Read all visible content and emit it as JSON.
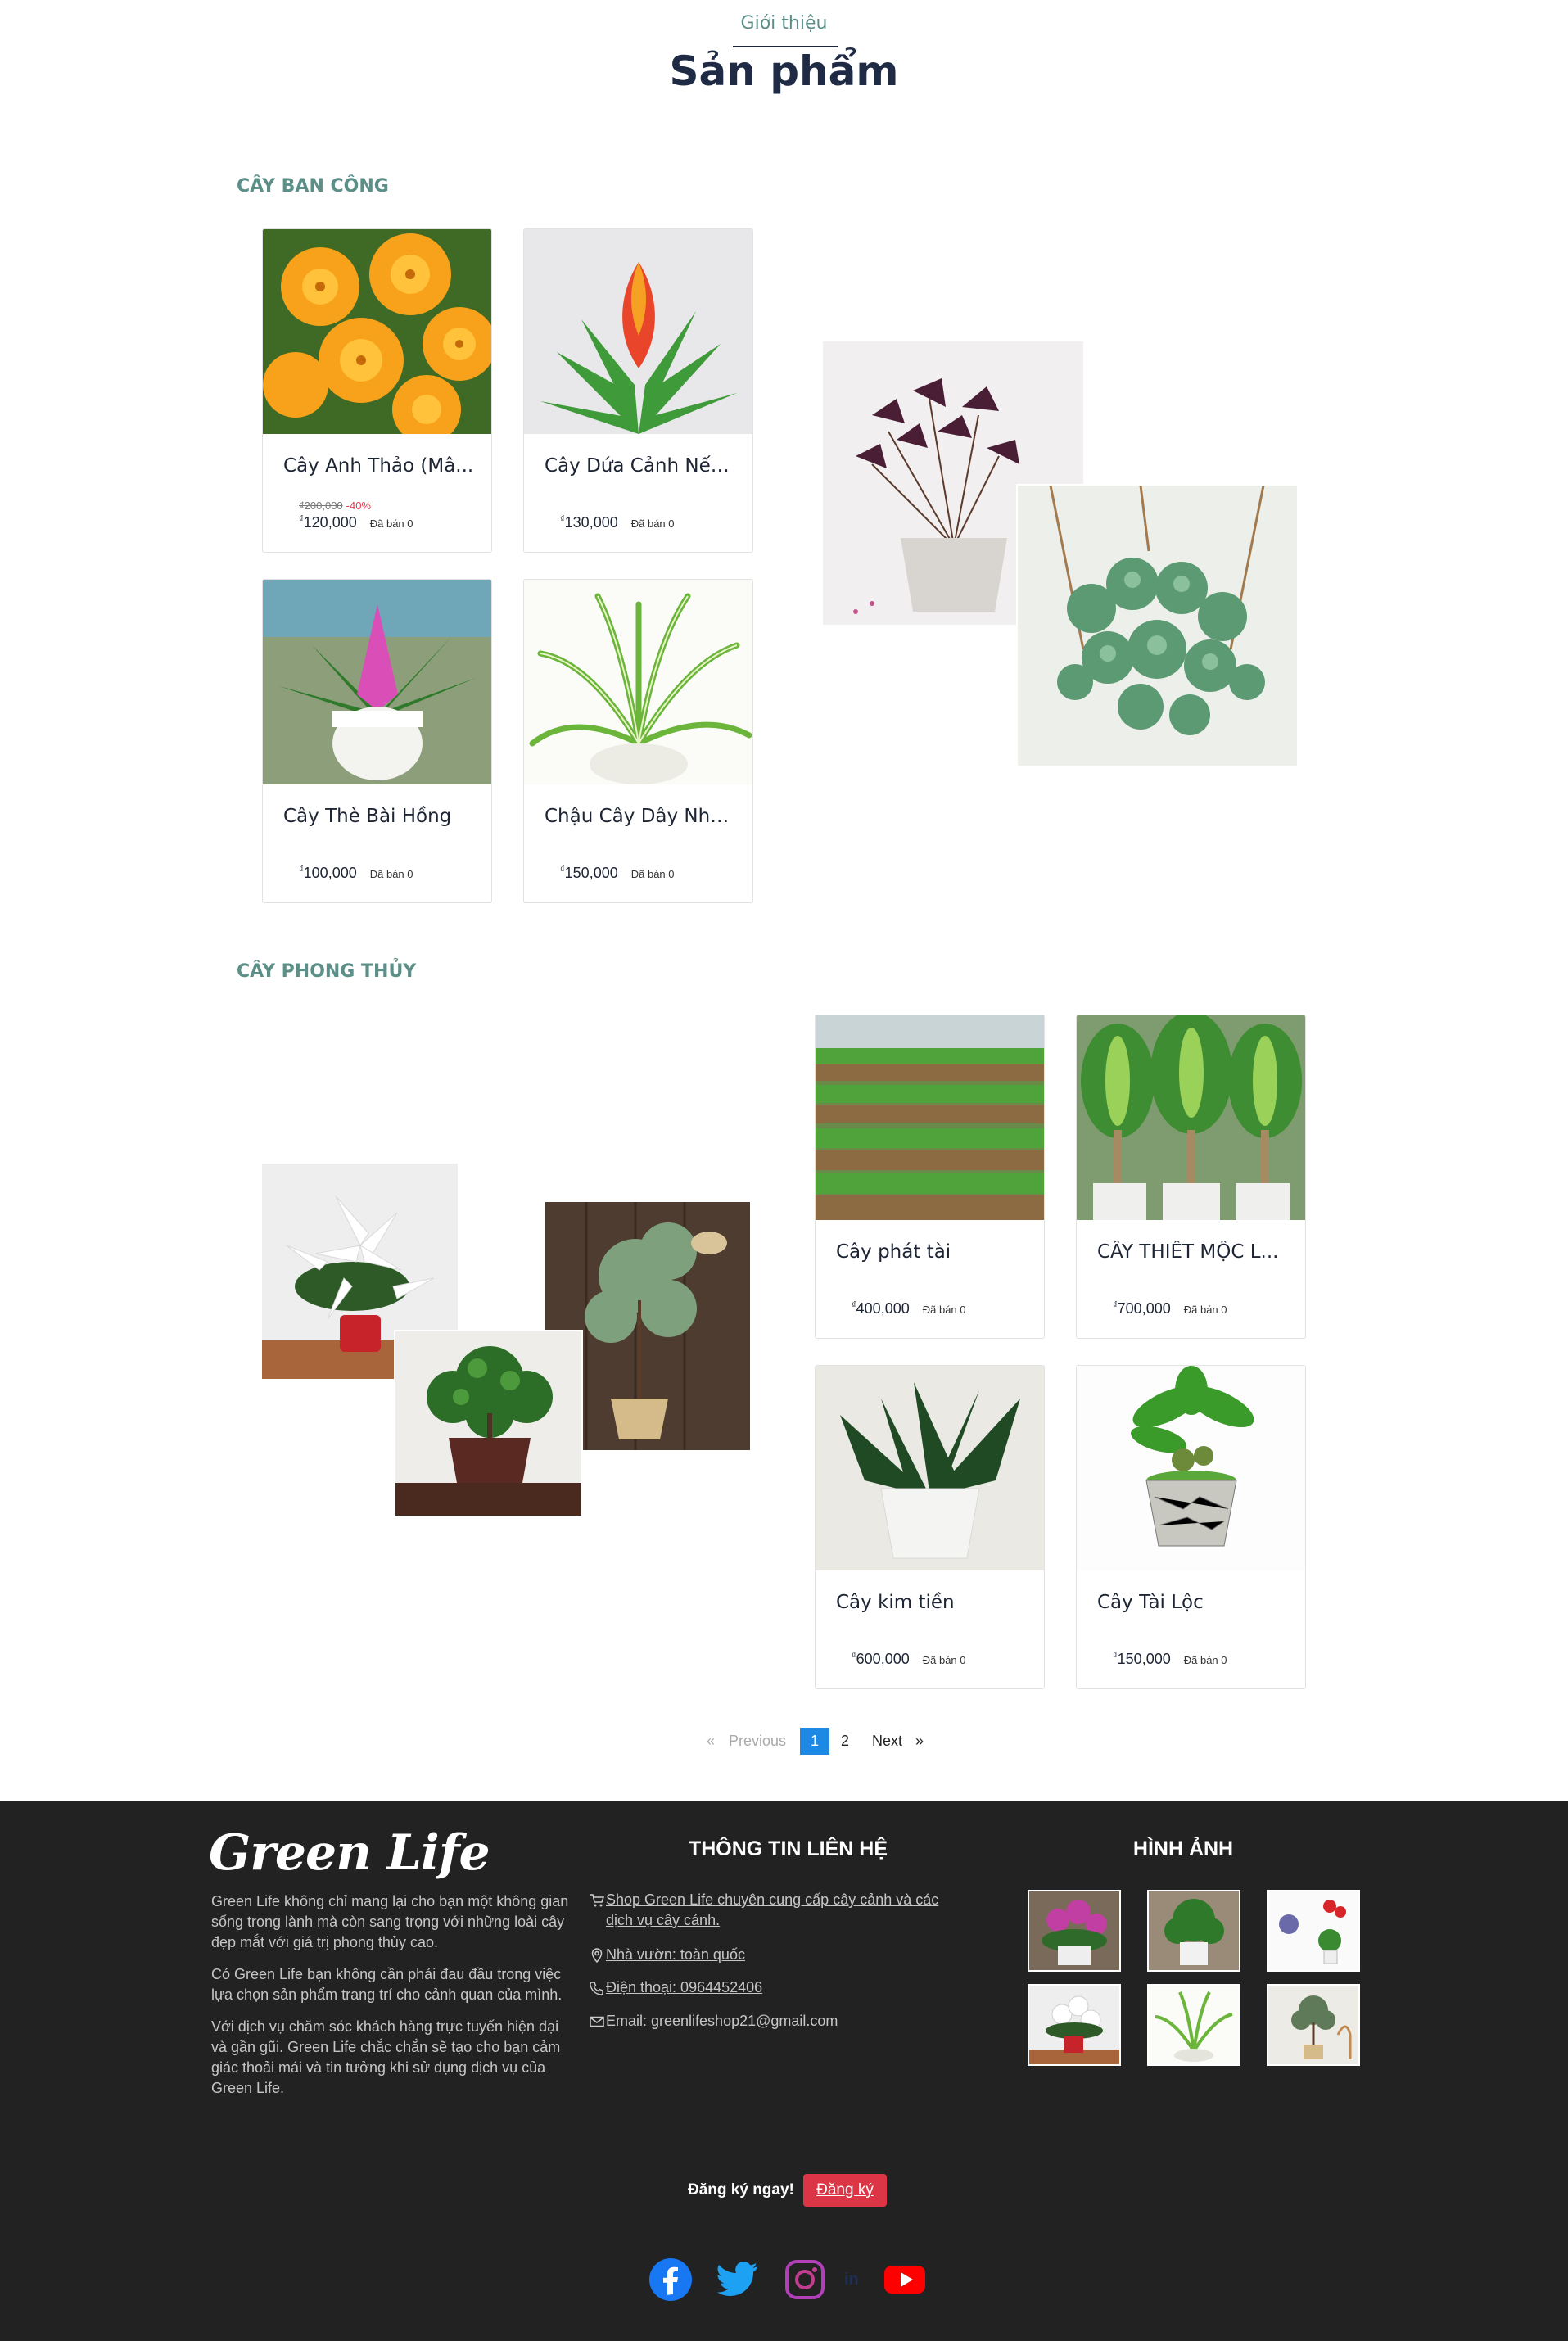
{
  "header": {
    "intro_link": "Giới thiệu",
    "title": "Sản phẩm"
  },
  "sections": [
    {
      "title": "CÂY BAN CÔNG",
      "products": [
        {
          "name": "Cây Anh Thảo (Mâ...",
          "old_price": "₫200,000",
          "discount": "-40%",
          "currency": "₫",
          "price": "120,000",
          "sold": "Đã bán 0"
        },
        {
          "name": "Cây Dứa Cảnh Nến...",
          "currency": "₫",
          "price": "130,000",
          "sold": "Đã bán 0"
        },
        {
          "name": "Cây Thè Bài Hồng",
          "currency": "₫",
          "price": "100,000",
          "sold": "Đã bán 0"
        },
        {
          "name": "Chậu Cây Dây Nhệ...",
          "currency": "₫",
          "price": "150,000",
          "sold": "Đã bán 0"
        }
      ]
    },
    {
      "title": "CÂY PHONG THỦY",
      "products": [
        {
          "name": "Cây phát tài",
          "currency": "₫",
          "price": "400,000",
          "sold": "Đã bán 0"
        },
        {
          "name": "CÂY THIẾT MỘC L...",
          "currency": "₫",
          "price": "700,000",
          "sold": "Đã bán 0"
        },
        {
          "name": "Cây kim tiền",
          "currency": "₫",
          "price": "600,000",
          "sold": "Đã bán 0"
        },
        {
          "name": "Cây Tài Lộc",
          "currency": "₫",
          "price": "150,000",
          "sold": "Đã bán 0"
        }
      ]
    }
  ],
  "pagination": {
    "prev_arrow": "«",
    "prev": "Previous",
    "pages": [
      "1",
      "2"
    ],
    "active_page": "1",
    "next": "Next",
    "next_arrow": "»"
  },
  "footer": {
    "logo": "Green Life",
    "about": [
      "Green Life không chỉ mang lại cho bạn một không gian sống trong lành mà còn sang trọng với những loài cây đẹp mắt với giá trị phong thủy cao.",
      "Có Green Life bạn không cần phải đau đầu trong việc lựa chọn sản phẩm trang trí cho cảnh quan của mình.",
      "Với dịch vụ chăm sóc khách hàng trực tuyến hiện đại và gần gũi. Green Life chắc chắn sẽ tạo cho bạn cảm giác thoải mái và tin tưởng khi sử dụng dịch vụ của Green Life."
    ],
    "contact_heading": "THÔNG TIN LIÊN HỆ",
    "contact": [
      {
        "icon": "cart-icon",
        "text": "Shop Green Life chuyên cung cấp cây cảnh và các dịch vụ cây cảnh."
      },
      {
        "icon": "map-pin-icon",
        "text": "Nhà vườn: toàn quốc"
      },
      {
        "icon": "phone-icon",
        "text": "Điện thoại: 0964452406"
      },
      {
        "icon": "envelope-icon",
        "text": "Email: greenlifeshop21@gmail.com"
      }
    ],
    "gallery_heading": "HÌNH ẢNH",
    "subscribe_label": "Đăng ký ngay!",
    "subscribe_button": "Đăng ký",
    "social": [
      "facebook-icon",
      "twitter-icon",
      "instagram-icon",
      "linkedin-icon",
      "youtube-icon"
    ]
  },
  "colors": {
    "accent": "#5b8f87",
    "active_page": "#1e88e5",
    "footer_bg": "#222222",
    "subscribe_btn": "#dc3545",
    "discount": "#e03b4e"
  }
}
